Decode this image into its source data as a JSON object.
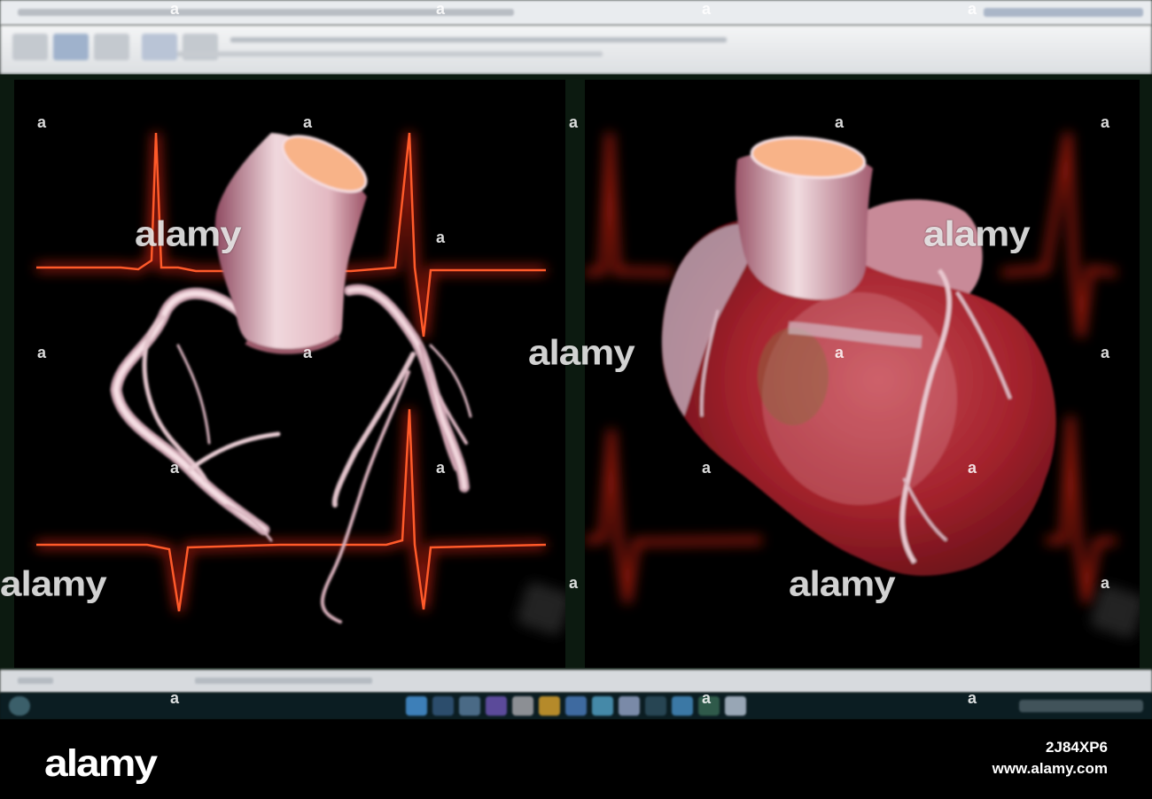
{
  "watermark": {
    "brand": "alamy",
    "letter": "a"
  },
  "footer": {
    "logo": "alamy",
    "image_id": "2J84XP6",
    "url": "www.alamy.com"
  },
  "colors": {
    "ecg_trace": "#ff2a12",
    "vessel_highlight": "#f3d8dc",
    "heart_muscle": "#b5232c",
    "aorta_cut": "#f8b388",
    "viewer_frame": "#0c1a10",
    "taskbar": "#0b1d22"
  },
  "views": [
    {
      "content": "coronary-arteries-3d-render"
    },
    {
      "content": "whole-heart-3d-render"
    }
  ]
}
